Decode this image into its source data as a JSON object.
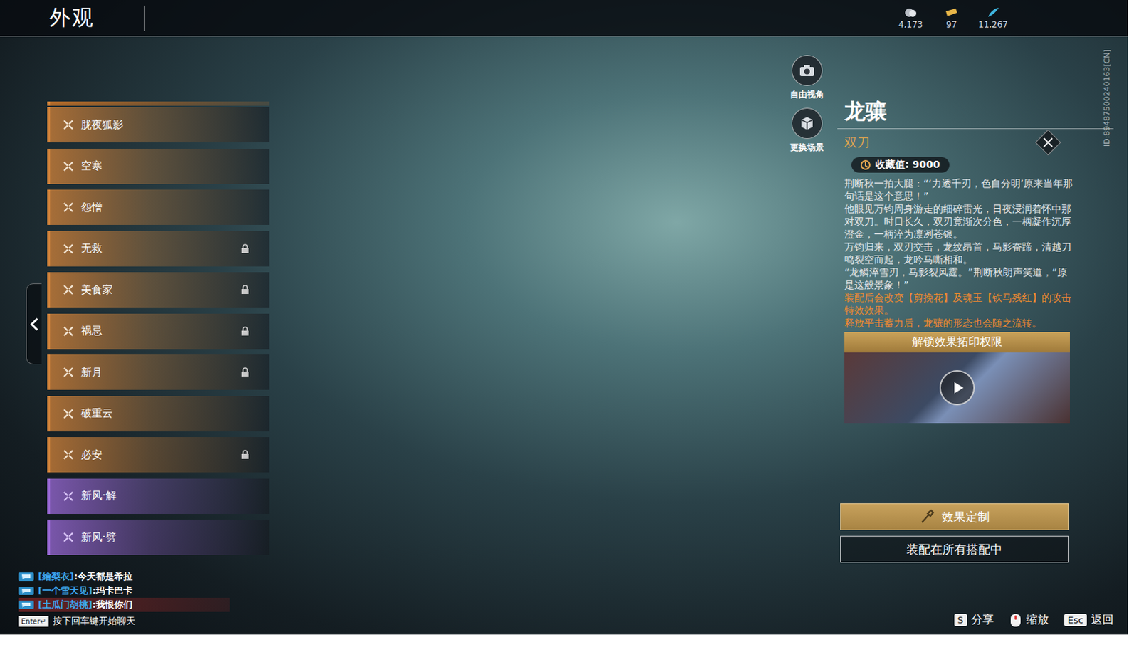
{
  "header": {
    "title": "外观",
    "currencies": [
      {
        "amount": "4,173",
        "kind": "coin",
        "color": "#b9bec6"
      },
      {
        "amount": "97",
        "kind": "ticket",
        "color": "#e6b548"
      },
      {
        "amount": "11,267",
        "kind": "feather",
        "color": "#3fb6e0"
      }
    ]
  },
  "player_id": "ID:89487500240163[CN]",
  "skins": [
    {
      "name": "胧夜狐影",
      "locked": false,
      "selected": false,
      "color": "#d4843a"
    },
    {
      "name": "空寒",
      "locked": false,
      "selected": false,
      "color": "#d4843a"
    },
    {
      "name": "怨憎",
      "locked": false,
      "selected": false,
      "color": "#d4843a"
    },
    {
      "name": "无救",
      "locked": true,
      "selected": false,
      "color": "#d4843a"
    },
    {
      "name": "美食家",
      "locked": true,
      "selected": false,
      "color": "#d4843a"
    },
    {
      "name": "祸忌",
      "locked": true,
      "selected": false,
      "color": "#d4843a"
    },
    {
      "name": "新月",
      "locked": true,
      "selected": false,
      "color": "#d4843a"
    },
    {
      "name": "破重云",
      "locked": false,
      "selected": false,
      "color": "#d4843a"
    },
    {
      "name": "必安",
      "locked": true,
      "selected": false,
      "color": "#d4843a"
    },
    {
      "name": "新风·解",
      "locked": false,
      "selected": false,
      "color": "#9b6ad8"
    },
    {
      "name": "新风·劈",
      "locked": false,
      "selected": false,
      "color": "#9b6ad8"
    }
  ],
  "view_buttons": [
    {
      "label": "自由视角",
      "kind": "camera"
    },
    {
      "label": "更换场景",
      "kind": "scene"
    }
  ],
  "item": {
    "name": "龙骧",
    "type": "双刀",
    "collection": "收藏值: 9000",
    "story": [
      "荆断秋一拍大腿：“‘力透千刃，色自分明’原来当年那句话是这个意思！”",
      "他眼见万钧周身游走的细碎雷光，日夜浸润着怀中那对双刀。时日长久，双刃竟渐次分色，一柄凝作沉厚澄金，一柄淬为凛冽苍银。",
      "万钧归来，双刃交击，龙纹昂首，马影奋蹄，清越刀鸣裂空而起，龙吟马嘶相和。",
      "“龙鳞淬雪刃，马影裂风霆。”荆断秋朗声笑道，“原是这般景象！”"
    ],
    "effects": [
      "装配后会改变【剪挽花】及魂玉【铁马残红】的攻击特效效果。",
      "释放平击蓄力后，龙骧的形态也会随之流转。"
    ],
    "preview": {
      "title": "解锁效果拓印权限"
    }
  },
  "actions": [
    {
      "label": "效果定制",
      "primary": true
    },
    {
      "label": "装配在所有搭配中",
      "primary": false
    }
  ],
  "chat": {
    "messages": [
      {
        "sender": "[繪梨衣]",
        "text": ":今天都是希拉",
        "highlighted": false
      },
      {
        "sender": "[一个雪天见]",
        "text": ":玛卡巴卡",
        "highlighted": false
      },
      {
        "sender": "[土瓜门胡桃]",
        "text": ":我恨你们",
        "highlighted": true
      }
    ],
    "prompt_key": "Enter↵",
    "prompt": "按下回车键开始聊天"
  },
  "hints": [
    {
      "kind": "key",
      "key": "S",
      "label": "分享"
    },
    {
      "kind": "mouse",
      "key": "",
      "label": "缩放"
    },
    {
      "kind": "key",
      "key": "Esc",
      "label": "返回"
    }
  ]
}
